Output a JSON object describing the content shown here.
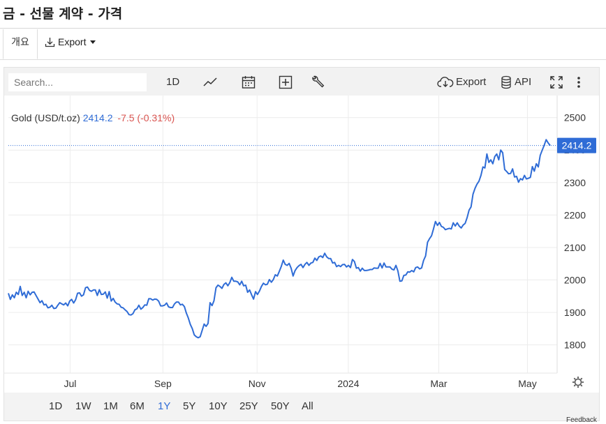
{
  "page": {
    "title": "금 - 선물 계약 - 가격"
  },
  "tabs": {
    "overview": "개요",
    "export": "Export"
  },
  "toolbar": {
    "search_placeholder": "Search...",
    "interval": "1D",
    "export": "Export",
    "api": "API"
  },
  "legend": {
    "symbol": "Gold (USD/t.oz)",
    "price": "2414.2",
    "change": "-7.5 (-0.31%)"
  },
  "colors": {
    "line": "#2f6cd6",
    "down": "#d9534f",
    "price_tag_bg": "#2f6cd6",
    "active_range": "#2f6cd6"
  },
  "ranges": [
    "1D",
    "1W",
    "1M",
    "6M",
    "1Y",
    "5Y",
    "10Y",
    "25Y",
    "50Y",
    "All"
  ],
  "active_range": "1Y",
  "feedback": "Feedback",
  "chart_data": {
    "type": "line",
    "title": "",
    "xlabel": "",
    "ylabel": "",
    "x_ticks": [
      "Jul",
      "Sep",
      "Nov",
      "2024",
      "Mar",
      "May"
    ],
    "y_ticks": [
      1800,
      1900,
      2000,
      2100,
      2200,
      2300,
      2400,
      2500
    ],
    "ylim": [
      1713,
      2568
    ],
    "last_value_label": "2414.2",
    "grid": true,
    "series": [
      {
        "values": [
          1959,
          1940,
          1954,
          1945,
          1962,
          1955,
          1980,
          1952,
          1962,
          1945,
          1965,
          1954,
          1962,
          1963,
          1952,
          1941,
          1930,
          1936,
          1923,
          1925,
          1914,
          1916,
          1922,
          1912,
          1913,
          1922,
          1930,
          1926,
          1923,
          1929,
          1920,
          1935,
          1940,
          1929,
          1939,
          1959,
          1960,
          1950,
          1954,
          1976,
          1978,
          1968,
          1965,
          1969,
          1969,
          1952,
          1970,
          1955,
          1956,
          1963,
          1944,
          1964,
          1935,
          1943,
          1932,
          1926,
          1925,
          1916,
          1914,
          1908,
          1903,
          1893,
          1892,
          1896,
          1908,
          1911,
          1922,
          1910,
          1915,
          1923,
          1922,
          1942,
          1942,
          1938,
          1941,
          1940,
          1935,
          1920,
          1920,
          1922,
          1929,
          1917,
          1915,
          1915,
          1926,
          1932,
          1932,
          1923,
          1925,
          1918,
          1898,
          1883,
          1863,
          1850,
          1831,
          1825,
          1822,
          1825,
          1844,
          1864,
          1857,
          1866,
          1930,
          1921,
          1936,
          1976,
          1984,
          1980,
          1974,
          1986,
          1991,
          1982,
          1992,
          2008,
          1996,
          1996,
          1994,
          1985,
          1996,
          1982,
          1984,
          1962,
          1969,
          1954,
          1941,
          1964,
          1955,
          1966,
          1980,
          1990,
          1985,
          1987,
          2001,
          1993,
          2001,
          2016,
          2012,
          2026,
          2041,
          2061,
          2048,
          2045,
          2051,
          2036,
          2012,
          2029,
          2038,
          2044,
          2048,
          2038,
          2048,
          2054,
          2045,
          2052,
          2054,
          2067,
          2060,
          2071,
          2074,
          2069,
          2082,
          2071,
          2066,
          2066,
          2052,
          2054,
          2041,
          2045,
          2041,
          2047,
          2048,
          2040,
          2045,
          2038,
          2063,
          2057,
          2036,
          2038,
          2027,
          2036,
          2029,
          2029,
          2030,
          2032,
          2032,
          2037,
          2036,
          2036,
          2051,
          2037,
          2052,
          2040,
          2040,
          2040,
          2033,
          2031,
          2045,
          2028,
          1996,
          1997,
          2014,
          2015,
          2025,
          2024,
          2029,
          2025,
          2038,
          2040,
          2034,
          2037,
          2060,
          2074,
          2116,
          2127,
          2136,
          2157,
          2180,
          2168,
          2177,
          2165,
          2162,
          2155,
          2157,
          2159,
          2157,
          2176,
          2166,
          2176,
          2166,
          2160,
          2169,
          2174,
          2192,
          2215,
          2225,
          2264,
          2282,
          2295,
          2304,
          2322,
          2348,
          2345,
          2388,
          2362,
          2370,
          2358,
          2380,
          2388,
          2370,
          2400,
          2392,
          2340,
          2334,
          2327,
          2328,
          2342,
          2317,
          2319,
          2301,
          2312,
          2308,
          2322,
          2311,
          2313,
          2316,
          2349,
          2335,
          2358,
          2348,
          2384,
          2400,
          2415,
          2432,
          2422,
          2414.2
        ]
      }
    ]
  }
}
